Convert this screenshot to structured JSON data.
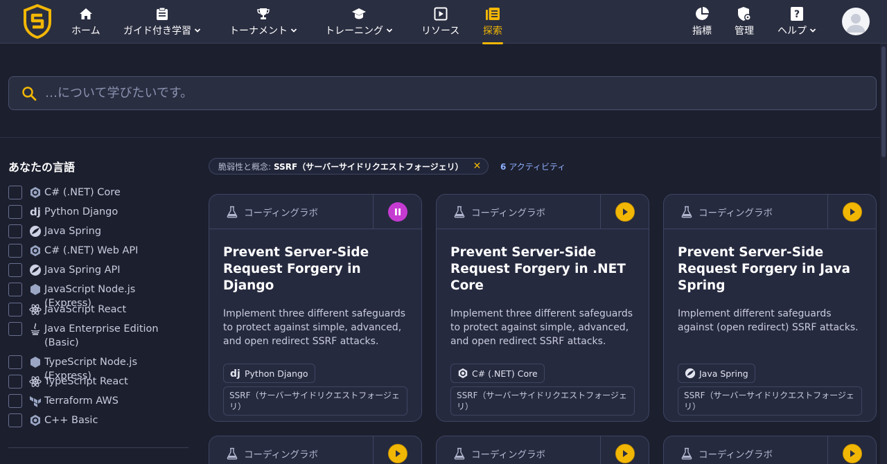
{
  "nav": {
    "items": [
      {
        "label": "ホーム",
        "icon": "home-icon"
      },
      {
        "label": "ガイド付き学習",
        "icon": "clipboard-icon"
      },
      {
        "label": "トーナメント",
        "icon": "trophy-icon"
      },
      {
        "label": "トレーニング",
        "icon": "graduation-cap-icon"
      },
      {
        "label": "リソース",
        "icon": "play-square-icon"
      },
      {
        "label": "探索",
        "icon": "library-icon"
      }
    ],
    "right": [
      {
        "label": "指標",
        "icon": "pie-chart-icon"
      },
      {
        "label": "管理",
        "icon": "shield-gear-icon"
      },
      {
        "label": "ヘルプ",
        "icon": "question-icon"
      }
    ],
    "active_color": "#f2b705"
  },
  "search": {
    "placeholder": "…について学びたいです。"
  },
  "sidebar": {
    "title": "あなたの言語",
    "languages": [
      "C# (.NET) Core",
      "Python Django",
      "Java Spring",
      "C# (.NET) Web API",
      "Java Spring API",
      "JavaScript Node.js (Express)",
      "JavaScript React",
      "Java Enterprise Edition (Basic)",
      "TypeScript Node.js (Express)",
      "TypeScript React",
      "Terraform AWS",
      "C++ Basic"
    ]
  },
  "filter": {
    "key": "脆弱性と概念:",
    "value": "SSRF（サーバーサイドリクエストフォージェリ）",
    "count": "6",
    "count_label": "アクティビティ"
  },
  "cards": [
    {
      "type": "コーディングラボ",
      "state": "pause",
      "title": "Prevent Server-Side Request Forgery in Django",
      "desc": "Implement three different safeguards to protect against simple, advanced, and open redirect SSRF attacks.",
      "tech": "Python Django",
      "vuln": "SSRF（サーバーサイドリクエストフォージェリ）"
    },
    {
      "type": "コーディングラボ",
      "state": "play",
      "title": "Prevent Server-Side Request Forgery in .NET Core",
      "desc": "Implement three different safeguards to protect against simple, advanced, and open redirect SSRF attacks.",
      "tech": "C# (.NET) Core",
      "vuln": "SSRF（サーバーサイドリクエストフォージェリ）"
    },
    {
      "type": "コーディングラボ",
      "state": "play",
      "title": "Prevent Server-Side Request Forgery in Java Spring",
      "desc": "Implement different safeguards against (open redirect) SSRF attacks.",
      "tech": "Java Spring",
      "vuln": "SSRF（サーバーサイドリクエストフォージェリ）"
    },
    {
      "type": "コーディングラボ",
      "state": "play"
    },
    {
      "type": "コーディングラボ",
      "state": "play"
    },
    {
      "type": "コーディングラボ",
      "state": "play"
    }
  ]
}
